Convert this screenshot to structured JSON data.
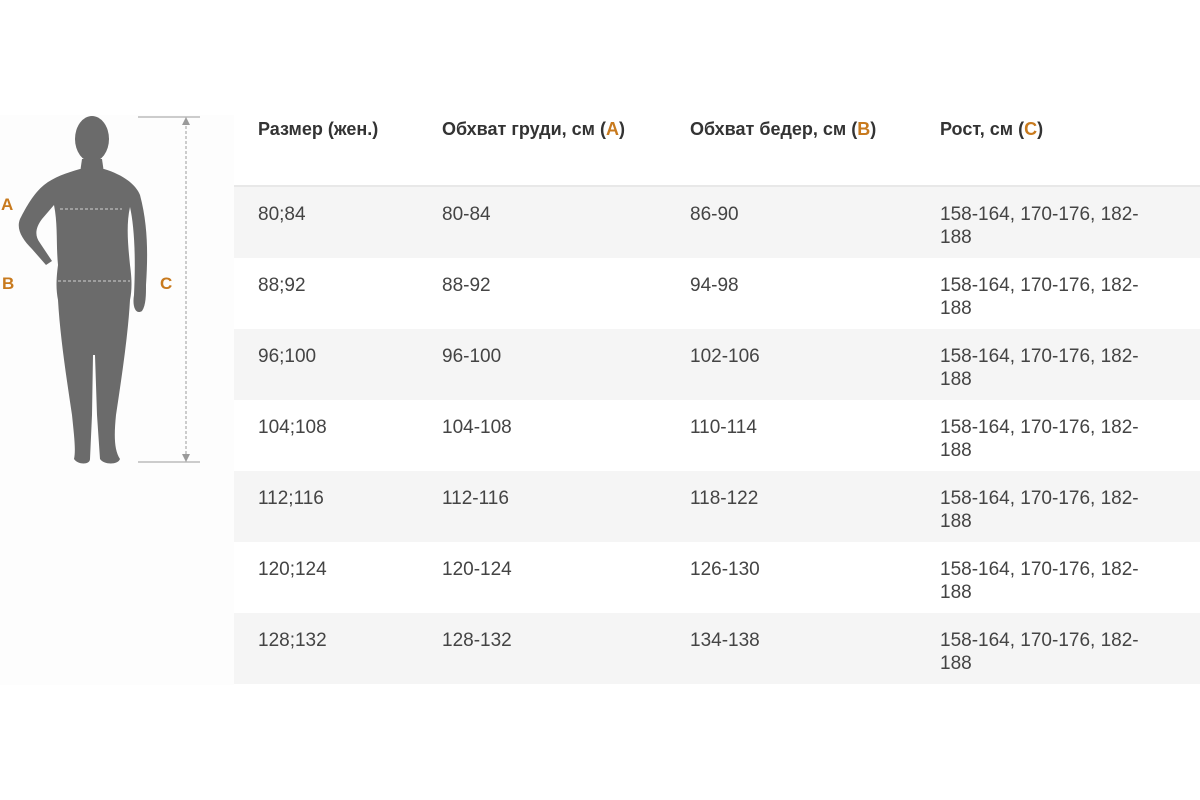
{
  "figure": {
    "markers": {
      "a": "A",
      "b": "B",
      "c": "C"
    },
    "silhouette_color": "#6b6b6b",
    "accent_color": "#c87a1e"
  },
  "table": {
    "headers": [
      {
        "text": "Размер (жен.)",
        "letter": ""
      },
      {
        "text": "Обхват груди, см",
        "letter": "A"
      },
      {
        "text": "Обхват бедер, см",
        "letter": "B"
      },
      {
        "text": "Рост, см",
        "letter": "C"
      }
    ],
    "rows": [
      [
        "80;84",
        "80-84",
        "86-90",
        "158-164, 170-176, 182-188"
      ],
      [
        "88;92",
        "88-92",
        "94-98",
        "158-164, 170-176, 182-188"
      ],
      [
        "96;100",
        "96-100",
        "102-106",
        "158-164, 170-176, 182-188"
      ],
      [
        "104;108",
        "104-108",
        "110-114",
        "158-164, 170-176, 182-188"
      ],
      [
        "112;116",
        "112-116",
        "118-122",
        "158-164, 170-176, 182-188"
      ],
      [
        "120;124",
        "120-124",
        "126-130",
        "158-164, 170-176, 182-188"
      ],
      [
        "128;132",
        "128-132",
        "134-138",
        "158-164, 170-176, 182-188"
      ]
    ]
  }
}
